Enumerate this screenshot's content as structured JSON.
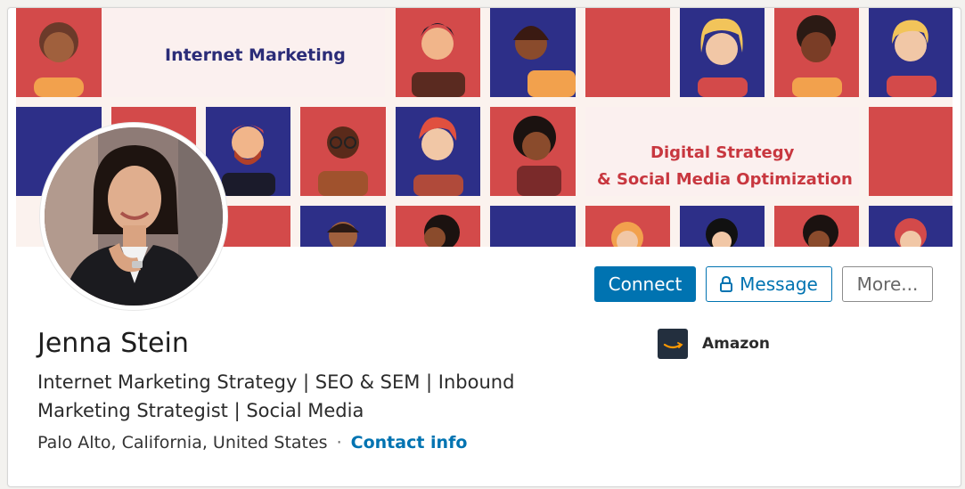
{
  "banner": {
    "heading_1": "Internet Marketing",
    "heading_2": "Digital Strategy",
    "heading_3": "& Social Media Optimization"
  },
  "profile": {
    "name": "Jenna Stein",
    "headline": "Internet Marketing Strategy | SEO & SEM | Inbound Marketing Strategist | Social Media",
    "location": "Palo Alto, California, United States",
    "separator": "·",
    "contact_info": "Contact info"
  },
  "actions": {
    "connect": "Connect",
    "message": "Message",
    "more": "More..."
  },
  "company": {
    "name": "Amazon"
  },
  "icons": {
    "lock": "lock-icon",
    "company_logo": "amazon-logo-icon"
  },
  "colors": {
    "primary": "#0073b1",
    "banner_red": "#d34a4a",
    "banner_blue": "#2d2f88",
    "banner_pink": "#fbf0ef"
  }
}
